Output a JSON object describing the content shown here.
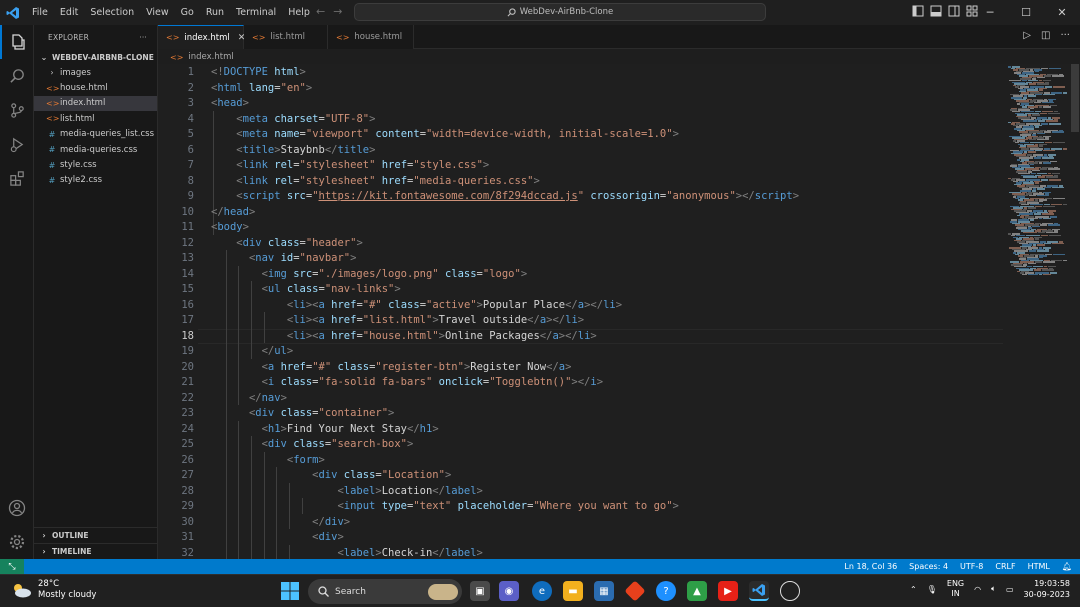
{
  "titlebar": {
    "menu": [
      "File",
      "Edit",
      "Selection",
      "View",
      "Go",
      "Run",
      "Terminal",
      "Help"
    ],
    "search_text": "WebDev-AirBnb-Clone"
  },
  "sidebar": {
    "header": "EXPLORER",
    "more": "···",
    "folder": "WEBDEV-AIRBNB-CLONE",
    "items": [
      {
        "label": "images",
        "kind": "folder"
      },
      {
        "label": "house.html",
        "kind": "html"
      },
      {
        "label": "index.html",
        "kind": "html"
      },
      {
        "label": "list.html",
        "kind": "html"
      },
      {
        "label": "media-queries_list.css",
        "kind": "css"
      },
      {
        "label": "media-queries.css",
        "kind": "css"
      },
      {
        "label": "style.css",
        "kind": "css"
      },
      {
        "label": "style2.css",
        "kind": "css"
      }
    ],
    "outline": "OUTLINE",
    "timeline": "TIMELINE"
  },
  "tabs": [
    {
      "label": "index.html"
    },
    {
      "label": "list.html"
    },
    {
      "label": "house.html"
    }
  ],
  "breadcrumb": "index.html",
  "editor": {
    "line_numbers": [
      "1",
      "2",
      "3",
      "4",
      "5",
      "6",
      "7",
      "8",
      "9",
      "10",
      "11",
      "12",
      "13",
      "14",
      "15",
      "16",
      "17",
      "18",
      "19",
      "20",
      "21",
      "22",
      "23",
      "24",
      "25",
      "26",
      "27",
      "28",
      "29",
      "30",
      "31",
      "32"
    ],
    "current_line": 18,
    "lines": [
      [
        [
          "br",
          "<!"
        ],
        [
          "tag",
          "DOCTYPE"
        ],
        [
          "tx",
          " "
        ],
        [
          "at",
          "html"
        ],
        [
          "br",
          ">"
        ]
      ],
      [
        [
          "br",
          "<"
        ],
        [
          "tag",
          "html"
        ],
        [
          "tx",
          " "
        ],
        [
          "at",
          "lang"
        ],
        [
          "tx",
          "="
        ],
        [
          "st",
          "\"en\""
        ],
        [
          "br",
          ">"
        ]
      ],
      [
        [
          "br",
          "<"
        ],
        [
          "tag",
          "head"
        ],
        [
          "br",
          ">"
        ]
      ],
      [
        [
          "tx",
          "    "
        ],
        [
          "br",
          "<"
        ],
        [
          "tag",
          "meta"
        ],
        [
          "tx",
          " "
        ],
        [
          "at",
          "charset"
        ],
        [
          "tx",
          "="
        ],
        [
          "st",
          "\"UTF-8\""
        ],
        [
          "br",
          ">"
        ]
      ],
      [
        [
          "tx",
          "    "
        ],
        [
          "br",
          "<"
        ],
        [
          "tag",
          "meta"
        ],
        [
          "tx",
          " "
        ],
        [
          "at",
          "name"
        ],
        [
          "tx",
          "="
        ],
        [
          "st",
          "\"viewport\""
        ],
        [
          "tx",
          " "
        ],
        [
          "at",
          "content"
        ],
        [
          "tx",
          "="
        ],
        [
          "st",
          "\"width=device-width, initial-scale=1.0\""
        ],
        [
          "br",
          ">"
        ]
      ],
      [
        [
          "tx",
          "    "
        ],
        [
          "br",
          "<"
        ],
        [
          "tag",
          "title"
        ],
        [
          "br",
          ">"
        ],
        [
          "tx",
          "Staybnb"
        ],
        [
          "br",
          "</"
        ],
        [
          "tag",
          "title"
        ],
        [
          "br",
          ">"
        ]
      ],
      [
        [
          "tx",
          "    "
        ],
        [
          "br",
          "<"
        ],
        [
          "tag",
          "link"
        ],
        [
          "tx",
          " "
        ],
        [
          "at",
          "rel"
        ],
        [
          "tx",
          "="
        ],
        [
          "st",
          "\"stylesheet\""
        ],
        [
          "tx",
          " "
        ],
        [
          "at",
          "href"
        ],
        [
          "tx",
          "="
        ],
        [
          "st",
          "\"style.css\""
        ],
        [
          "br",
          ">"
        ]
      ],
      [
        [
          "tx",
          "    "
        ],
        [
          "br",
          "<"
        ],
        [
          "tag",
          "link"
        ],
        [
          "tx",
          " "
        ],
        [
          "at",
          "rel"
        ],
        [
          "tx",
          "="
        ],
        [
          "st",
          "\"stylesheet\""
        ],
        [
          "tx",
          " "
        ],
        [
          "at",
          "href"
        ],
        [
          "tx",
          "="
        ],
        [
          "st",
          "\"media-queries.css\""
        ],
        [
          "br",
          ">"
        ]
      ],
      [
        [
          "tx",
          "    "
        ],
        [
          "br",
          "<"
        ],
        [
          "tag",
          "script"
        ],
        [
          "tx",
          " "
        ],
        [
          "at",
          "src"
        ],
        [
          "tx",
          "="
        ],
        [
          "st",
          "\""
        ],
        [
          "url",
          "https://kit.fontawesome.com/8f294dccad.js"
        ],
        [
          "st",
          "\""
        ],
        [
          "tx",
          " "
        ],
        [
          "at",
          "crossorigin"
        ],
        [
          "tx",
          "="
        ],
        [
          "st",
          "\"anonymous\""
        ],
        [
          "br",
          "></"
        ],
        [
          "tag",
          "script"
        ],
        [
          "br",
          ">"
        ]
      ],
      [
        [
          "br",
          "</"
        ],
        [
          "tag",
          "head"
        ],
        [
          "br",
          ">"
        ]
      ],
      [
        [
          "br",
          "<"
        ],
        [
          "tag",
          "body"
        ],
        [
          "br",
          ">"
        ]
      ],
      [
        [
          "tx",
          "    "
        ],
        [
          "br",
          "<"
        ],
        [
          "tag",
          "div"
        ],
        [
          "tx",
          " "
        ],
        [
          "at",
          "class"
        ],
        [
          "tx",
          "="
        ],
        [
          "st",
          "\"header\""
        ],
        [
          "br",
          ">"
        ]
      ],
      [
        [
          "tx",
          "      "
        ],
        [
          "br",
          "<"
        ],
        [
          "tag",
          "nav"
        ],
        [
          "tx",
          " "
        ],
        [
          "at",
          "id"
        ],
        [
          "tx",
          "="
        ],
        [
          "st",
          "\"navbar\""
        ],
        [
          "br",
          ">"
        ]
      ],
      [
        [
          "tx",
          "        "
        ],
        [
          "br",
          "<"
        ],
        [
          "tag",
          "img"
        ],
        [
          "tx",
          " "
        ],
        [
          "at",
          "src"
        ],
        [
          "tx",
          "="
        ],
        [
          "st",
          "\"./images/logo.png\""
        ],
        [
          "tx",
          " "
        ],
        [
          "at",
          "class"
        ],
        [
          "tx",
          "="
        ],
        [
          "st",
          "\"logo\""
        ],
        [
          "br",
          ">"
        ]
      ],
      [
        [
          "tx",
          "        "
        ],
        [
          "br",
          "<"
        ],
        [
          "tag",
          "ul"
        ],
        [
          "tx",
          " "
        ],
        [
          "at",
          "class"
        ],
        [
          "tx",
          "="
        ],
        [
          "st",
          "\"nav-links\""
        ],
        [
          "br",
          ">"
        ]
      ],
      [
        [
          "tx",
          "            "
        ],
        [
          "br",
          "<"
        ],
        [
          "tag",
          "li"
        ],
        [
          "br",
          "><"
        ],
        [
          "tag",
          "a"
        ],
        [
          "tx",
          " "
        ],
        [
          "at",
          "href"
        ],
        [
          "tx",
          "="
        ],
        [
          "st",
          "\"#\""
        ],
        [
          "tx",
          " "
        ],
        [
          "at",
          "class"
        ],
        [
          "tx",
          "="
        ],
        [
          "st",
          "\"active\""
        ],
        [
          "br",
          ">"
        ],
        [
          "tx",
          "Popular Place"
        ],
        [
          "br",
          "</"
        ],
        [
          "tag",
          "a"
        ],
        [
          "br",
          "></"
        ],
        [
          "tag",
          "li"
        ],
        [
          "br",
          ">"
        ]
      ],
      [
        [
          "tx",
          "            "
        ],
        [
          "br",
          "<"
        ],
        [
          "tag",
          "li"
        ],
        [
          "br",
          "><"
        ],
        [
          "tag",
          "a"
        ],
        [
          "tx",
          " "
        ],
        [
          "at",
          "href"
        ],
        [
          "tx",
          "="
        ],
        [
          "st",
          "\"list.html\""
        ],
        [
          "br",
          ">"
        ],
        [
          "tx",
          "Travel outside"
        ],
        [
          "br",
          "</"
        ],
        [
          "tag",
          "a"
        ],
        [
          "br",
          "></"
        ],
        [
          "tag",
          "li"
        ],
        [
          "br",
          ">"
        ]
      ],
      [
        [
          "tx",
          "            "
        ],
        [
          "br",
          "<"
        ],
        [
          "tag",
          "li"
        ],
        [
          "br",
          "><"
        ],
        [
          "tag",
          "a"
        ],
        [
          "tx",
          " "
        ],
        [
          "at",
          "href"
        ],
        [
          "tx",
          "="
        ],
        [
          "st",
          "\"house.html\""
        ],
        [
          "br",
          ">"
        ],
        [
          "tx",
          "Online Packages"
        ],
        [
          "br",
          "</"
        ],
        [
          "tag",
          "a"
        ],
        [
          "br",
          "></"
        ],
        [
          "tag",
          "li"
        ],
        [
          "br",
          ">"
        ]
      ],
      [
        [
          "tx",
          "        "
        ],
        [
          "br",
          "</"
        ],
        [
          "tag",
          "ul"
        ],
        [
          "br",
          ">"
        ]
      ],
      [
        [
          "tx",
          "        "
        ],
        [
          "br",
          "<"
        ],
        [
          "tag",
          "a"
        ],
        [
          "tx",
          " "
        ],
        [
          "at",
          "href"
        ],
        [
          "tx",
          "="
        ],
        [
          "st",
          "\"#\""
        ],
        [
          "tx",
          " "
        ],
        [
          "at",
          "class"
        ],
        [
          "tx",
          "="
        ],
        [
          "st",
          "\"register-btn\""
        ],
        [
          "br",
          ">"
        ],
        [
          "tx",
          "Register Now"
        ],
        [
          "br",
          "</"
        ],
        [
          "tag",
          "a"
        ],
        [
          "br",
          ">"
        ]
      ],
      [
        [
          "tx",
          "        "
        ],
        [
          "br",
          "<"
        ],
        [
          "tag",
          "i"
        ],
        [
          "tx",
          " "
        ],
        [
          "at",
          "class"
        ],
        [
          "tx",
          "="
        ],
        [
          "st",
          "\"fa-solid fa-bars\""
        ],
        [
          "tx",
          " "
        ],
        [
          "at",
          "onclick"
        ],
        [
          "tx",
          "="
        ],
        [
          "st",
          "\"Togglebtn()\""
        ],
        [
          "br",
          "></"
        ],
        [
          "tag",
          "i"
        ],
        [
          "br",
          ">"
        ]
      ],
      [
        [
          "tx",
          "      "
        ],
        [
          "br",
          "</"
        ],
        [
          "tag",
          "nav"
        ],
        [
          "br",
          ">"
        ]
      ],
      [
        [
          "tx",
          "      "
        ],
        [
          "br",
          "<"
        ],
        [
          "tag",
          "div"
        ],
        [
          "tx",
          " "
        ],
        [
          "at",
          "class"
        ],
        [
          "tx",
          "="
        ],
        [
          "st",
          "\"container\""
        ],
        [
          "br",
          ">"
        ]
      ],
      [
        [
          "tx",
          "        "
        ],
        [
          "br",
          "<"
        ],
        [
          "tag",
          "h1"
        ],
        [
          "br",
          ">"
        ],
        [
          "tx",
          "Find Your Next Stay"
        ],
        [
          "br",
          "</"
        ],
        [
          "tag",
          "h1"
        ],
        [
          "br",
          ">"
        ]
      ],
      [
        [
          "tx",
          "        "
        ],
        [
          "br",
          "<"
        ],
        [
          "tag",
          "div"
        ],
        [
          "tx",
          " "
        ],
        [
          "at",
          "class"
        ],
        [
          "tx",
          "="
        ],
        [
          "st",
          "\"search-box\""
        ],
        [
          "br",
          ">"
        ]
      ],
      [
        [
          "tx",
          "            "
        ],
        [
          "br",
          "<"
        ],
        [
          "tag",
          "form"
        ],
        [
          "br",
          ">"
        ]
      ],
      [
        [
          "tx",
          "                "
        ],
        [
          "br",
          "<"
        ],
        [
          "tag",
          "div"
        ],
        [
          "tx",
          " "
        ],
        [
          "at",
          "class"
        ],
        [
          "tx",
          "="
        ],
        [
          "st",
          "\"Location\""
        ],
        [
          "br",
          ">"
        ]
      ],
      [
        [
          "tx",
          "                    "
        ],
        [
          "br",
          "<"
        ],
        [
          "tag",
          "label"
        ],
        [
          "br",
          ">"
        ],
        [
          "tx",
          "Location"
        ],
        [
          "br",
          "</"
        ],
        [
          "tag",
          "label"
        ],
        [
          "br",
          ">"
        ]
      ],
      [
        [
          "tx",
          "                    "
        ],
        [
          "br",
          "<"
        ],
        [
          "tag",
          "input"
        ],
        [
          "tx",
          " "
        ],
        [
          "at",
          "type"
        ],
        [
          "tx",
          "="
        ],
        [
          "st",
          "\"text\""
        ],
        [
          "tx",
          " "
        ],
        [
          "at",
          "placeholder"
        ],
        [
          "tx",
          "="
        ],
        [
          "st",
          "\"Where you want to go\""
        ],
        [
          "br",
          ">"
        ]
      ],
      [
        [
          "tx",
          "                "
        ],
        [
          "br",
          "</"
        ],
        [
          "tag",
          "div"
        ],
        [
          "br",
          ">"
        ]
      ],
      [
        [
          "tx",
          "                "
        ],
        [
          "br",
          "<"
        ],
        [
          "tag",
          "div"
        ],
        [
          "br",
          ">"
        ]
      ],
      [
        [
          "tx",
          "                    "
        ],
        [
          "br",
          "<"
        ],
        [
          "tag",
          "label"
        ],
        [
          "br",
          ">"
        ],
        [
          "tx",
          "Check-in"
        ],
        [
          "br",
          "</"
        ],
        [
          "tag",
          "label"
        ],
        [
          "br",
          ">"
        ]
      ]
    ]
  },
  "statusbar": {
    "position": "Ln 18, Col 36",
    "spaces": "Spaces: 4",
    "encoding": "UTF-8",
    "eol": "CRLF",
    "language": "HTML"
  },
  "taskbar": {
    "temperature": "28°C",
    "weather": "Mostly cloudy",
    "search": "Search",
    "lang_top": "ENG",
    "lang_bottom": "IN",
    "time": "19:03:58",
    "date": "30-09-2023"
  },
  "colors": {
    "accent": "#0078d4",
    "statusbar": "#007acc",
    "tag": "#569cd6",
    "attribute": "#9cdcfe",
    "string": "#ce9178"
  }
}
